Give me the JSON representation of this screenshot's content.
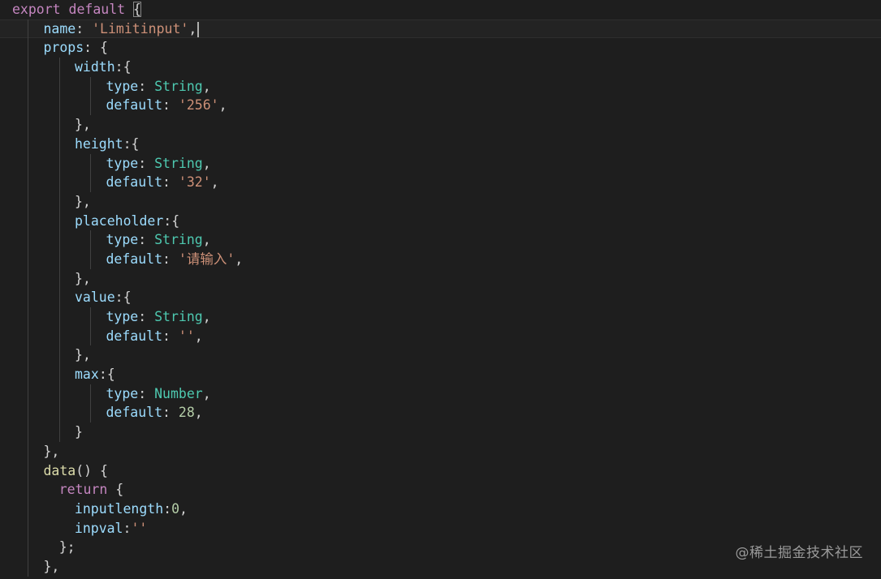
{
  "editor": {
    "colors": {
      "background": "#1e1e1e",
      "keyword": "#c586c0",
      "property": "#9cdcfe",
      "string": "#ce9178",
      "type": "#4ec9b0",
      "number": "#b5cea8",
      "function": "#dcdcaa",
      "keyword_blue": "#569cd6",
      "punctuation": "#d4d4d4"
    },
    "current_line_index": 1,
    "lines": [
      {
        "indent": 0,
        "tokens": [
          {
            "t": "export",
            "c": "keyword"
          },
          {
            "t": " ",
            "c": "punctuation"
          },
          {
            "t": "default",
            "c": "keyword"
          },
          {
            "t": " ",
            "c": "punctuation"
          },
          {
            "t": "{",
            "c": "punctuation",
            "hl": true
          }
        ]
      },
      {
        "indent": 1,
        "tokens": [
          {
            "t": "name",
            "c": "property"
          },
          {
            "t": ": ",
            "c": "punctuation"
          },
          {
            "t": "'Limitinput'",
            "c": "string"
          },
          {
            "t": ",",
            "c": "punctuation"
          }
        ],
        "cursor": true
      },
      {
        "indent": 1,
        "tokens": [
          {
            "t": "props",
            "c": "property"
          },
          {
            "t": ": {",
            "c": "punctuation"
          }
        ]
      },
      {
        "indent": 2,
        "tokens": [
          {
            "t": "width",
            "c": "property"
          },
          {
            "t": ":{",
            "c": "punctuation"
          }
        ]
      },
      {
        "indent": 3,
        "tokens": [
          {
            "t": "type",
            "c": "property"
          },
          {
            "t": ": ",
            "c": "punctuation"
          },
          {
            "t": "String",
            "c": "type"
          },
          {
            "t": ",",
            "c": "punctuation"
          }
        ]
      },
      {
        "indent": 3,
        "tokens": [
          {
            "t": "default",
            "c": "property"
          },
          {
            "t": ": ",
            "c": "punctuation"
          },
          {
            "t": "'256'",
            "c": "string"
          },
          {
            "t": ",",
            "c": "punctuation"
          }
        ]
      },
      {
        "indent": 2,
        "tokens": [
          {
            "t": "},",
            "c": "punctuation"
          }
        ]
      },
      {
        "indent": 2,
        "tokens": [
          {
            "t": "height",
            "c": "property"
          },
          {
            "t": ":{",
            "c": "punctuation"
          }
        ]
      },
      {
        "indent": 3,
        "tokens": [
          {
            "t": "type",
            "c": "property"
          },
          {
            "t": ": ",
            "c": "punctuation"
          },
          {
            "t": "String",
            "c": "type"
          },
          {
            "t": ",",
            "c": "punctuation"
          }
        ]
      },
      {
        "indent": 3,
        "tokens": [
          {
            "t": "default",
            "c": "property"
          },
          {
            "t": ": ",
            "c": "punctuation"
          },
          {
            "t": "'32'",
            "c": "string"
          },
          {
            "t": ",",
            "c": "punctuation"
          }
        ]
      },
      {
        "indent": 2,
        "tokens": [
          {
            "t": "},",
            "c": "punctuation"
          }
        ]
      },
      {
        "indent": 2,
        "tokens": [
          {
            "t": "placeholder",
            "c": "property"
          },
          {
            "t": ":{",
            "c": "punctuation"
          }
        ]
      },
      {
        "indent": 3,
        "tokens": [
          {
            "t": "type",
            "c": "property"
          },
          {
            "t": ": ",
            "c": "punctuation"
          },
          {
            "t": "String",
            "c": "type"
          },
          {
            "t": ",",
            "c": "punctuation"
          }
        ]
      },
      {
        "indent": 3,
        "tokens": [
          {
            "t": "default",
            "c": "property"
          },
          {
            "t": ": ",
            "c": "punctuation"
          },
          {
            "t": "'请输入'",
            "c": "string"
          },
          {
            "t": ",",
            "c": "punctuation"
          }
        ]
      },
      {
        "indent": 2,
        "tokens": [
          {
            "t": "},",
            "c": "punctuation"
          }
        ]
      },
      {
        "indent": 2,
        "tokens": [
          {
            "t": "value",
            "c": "property"
          },
          {
            "t": ":{",
            "c": "punctuation"
          }
        ]
      },
      {
        "indent": 3,
        "tokens": [
          {
            "t": "type",
            "c": "property"
          },
          {
            "t": ": ",
            "c": "punctuation"
          },
          {
            "t": "String",
            "c": "type"
          },
          {
            "t": ",",
            "c": "punctuation"
          }
        ]
      },
      {
        "indent": 3,
        "tokens": [
          {
            "t": "default",
            "c": "property"
          },
          {
            "t": ": ",
            "c": "punctuation"
          },
          {
            "t": "''",
            "c": "string"
          },
          {
            "t": ",",
            "c": "punctuation"
          }
        ]
      },
      {
        "indent": 2,
        "tokens": [
          {
            "t": "},",
            "c": "punctuation"
          }
        ]
      },
      {
        "indent": 2,
        "tokens": [
          {
            "t": "max",
            "c": "property"
          },
          {
            "t": ":{",
            "c": "punctuation"
          }
        ]
      },
      {
        "indent": 3,
        "tokens": [
          {
            "t": "type",
            "c": "property"
          },
          {
            "t": ": ",
            "c": "punctuation"
          },
          {
            "t": "Number",
            "c": "type"
          },
          {
            "t": ",",
            "c": "punctuation"
          }
        ]
      },
      {
        "indent": 3,
        "tokens": [
          {
            "t": "default",
            "c": "property"
          },
          {
            "t": ": ",
            "c": "punctuation"
          },
          {
            "t": "28",
            "c": "number"
          },
          {
            "t": ",",
            "c": "punctuation"
          }
        ]
      },
      {
        "indent": 2,
        "tokens": [
          {
            "t": "}",
            "c": "punctuation"
          }
        ]
      },
      {
        "indent": 1,
        "tokens": [
          {
            "t": "},",
            "c": "punctuation"
          }
        ]
      },
      {
        "indent": 1,
        "tokens": [
          {
            "t": "data",
            "c": "function"
          },
          {
            "t": "() {",
            "c": "punctuation"
          }
        ]
      },
      {
        "indent": 1,
        "sub": 1,
        "tokens": [
          {
            "t": "return",
            "c": "keyword"
          },
          {
            "t": " {",
            "c": "punctuation"
          }
        ]
      },
      {
        "indent": 1,
        "sub": 2,
        "tokens": [
          {
            "t": "inputlength",
            "c": "property"
          },
          {
            "t": ":",
            "c": "punctuation"
          },
          {
            "t": "0",
            "c": "number"
          },
          {
            "t": ",",
            "c": "punctuation"
          }
        ]
      },
      {
        "indent": 1,
        "sub": 2,
        "tokens": [
          {
            "t": "inpval",
            "c": "property"
          },
          {
            "t": ":",
            "c": "punctuation"
          },
          {
            "t": "''",
            "c": "string"
          }
        ]
      },
      {
        "indent": 1,
        "sub": 1,
        "tokens": [
          {
            "t": "};",
            "c": "punctuation"
          }
        ]
      },
      {
        "indent": 1,
        "tokens": [
          {
            "t": "},",
            "c": "punctuation"
          }
        ]
      }
    ]
  },
  "watermark": {
    "text": "@稀土掘金技术社区"
  }
}
